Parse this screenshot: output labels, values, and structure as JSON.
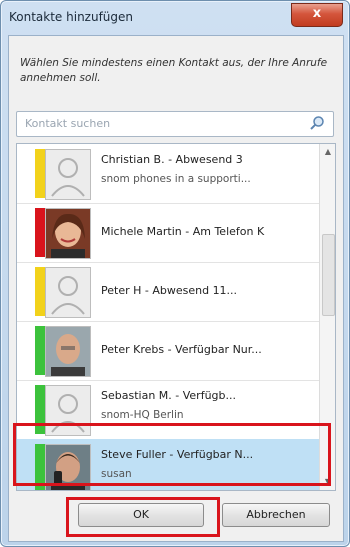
{
  "window": {
    "title": "Kontakte hinzufügen",
    "close_label": "x"
  },
  "instruction": "Wählen Sie mindestens einen Kontakt aus, der Ihre Anrufe annehmen soll.",
  "search": {
    "placeholder": "Kontakt suchen"
  },
  "contacts": [
    {
      "name_status": "Christian B.    - Abwesend 3",
      "sub": "snom phones in a supporti...",
      "status_color": "#f2d21b",
      "avatar": "placeholder"
    },
    {
      "name_status": "Michele Martin - Am Telefon  K",
      "sub": "",
      "status_color": "#d9141c",
      "avatar": "photo"
    },
    {
      "name_status": "Peter H         - Abwesend 11...",
      "sub": "",
      "status_color": "#f2d21b",
      "avatar": "placeholder"
    },
    {
      "name_status": "Peter Krebs - Verfügbar  Nur...",
      "sub": "",
      "status_color": "#3cc23c",
      "avatar": "photo"
    },
    {
      "name_status": "Sebastian M.        - Verfügb...",
      "sub": "snom-HQ Berlin",
      "status_color": "#3cc23c",
      "avatar": "placeholder"
    },
    {
      "name_status": "Steve Fuller - Verfügbar  N...",
      "sub": "susan",
      "status_color": "#3cc23c",
      "avatar": "photo",
      "selected": true
    }
  ],
  "buttons": {
    "ok": "OK",
    "cancel": "Abbrechen"
  },
  "colors": {
    "available": "#3cc23c",
    "away": "#f2d21b",
    "busy": "#d9141c",
    "highlight": "#d9141c",
    "selection": "#bfe0f5"
  }
}
